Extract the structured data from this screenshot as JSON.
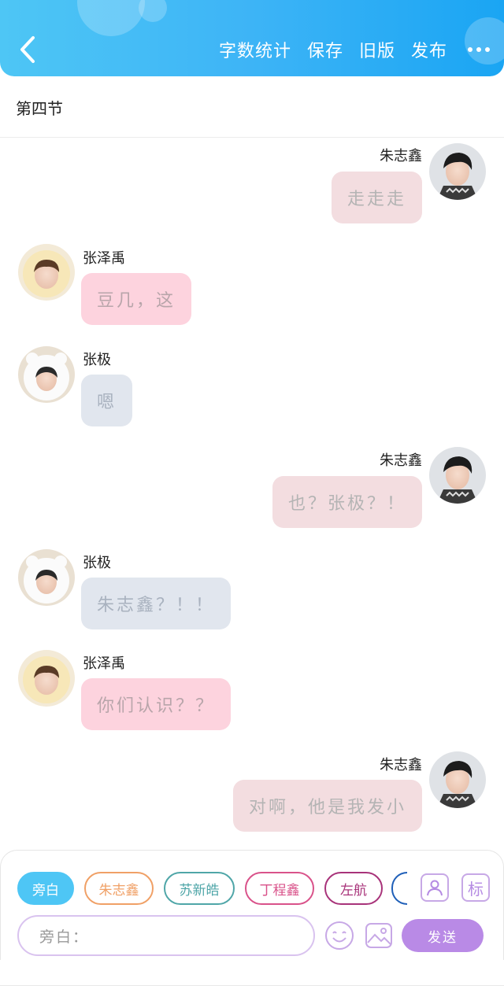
{
  "header": {
    "actions": [
      "字数统计",
      "保存",
      "旧版",
      "发布"
    ]
  },
  "section_title": "第四节",
  "messages": [
    {
      "side": "right",
      "name": "朱志鑫",
      "text": "走走走",
      "style": "self",
      "avatar": "avatar-zhu"
    },
    {
      "side": "left",
      "name": "张泽禹",
      "text": "豆几，这",
      "style": "pink",
      "avatar": "avatar-zhang-zeyu"
    },
    {
      "side": "left",
      "name": "张极",
      "text": "嗯",
      "style": "blue",
      "avatar": "avatar-zhang-ji"
    },
    {
      "side": "right",
      "name": "朱志鑫",
      "text": "也？张极？！",
      "style": "self",
      "avatar": "avatar-zhu"
    },
    {
      "side": "left",
      "name": "张极",
      "text": "朱志鑫？！！",
      "style": "blue",
      "avatar": "avatar-zhang-ji"
    },
    {
      "side": "left",
      "name": "张泽禹",
      "text": "你们认识？？",
      "style": "pink",
      "avatar": "avatar-zhang-zeyu"
    },
    {
      "side": "right",
      "name": "朱志鑫",
      "text": "对啊，他是我发小",
      "style": "self",
      "avatar": "avatar-zhu"
    }
  ],
  "roles": [
    {
      "label": "旁白",
      "color": "#4ec6f5",
      "active": true
    },
    {
      "label": "朱志鑫",
      "color": "#f0a066",
      "active": false
    },
    {
      "label": "苏新皓",
      "color": "#4fa6a8",
      "active": false
    },
    {
      "label": "丁程鑫",
      "color": "#d9528a",
      "active": false
    },
    {
      "label": "左航",
      "color": "#a8337a",
      "active": false
    }
  ],
  "tag_button": "标",
  "input": {
    "placeholder": "旁白："
  },
  "send_label": "发送",
  "colors": {
    "header_start": "#4ec6f5",
    "header_end": "#1aa5f3",
    "accent": "#b98ae6"
  }
}
